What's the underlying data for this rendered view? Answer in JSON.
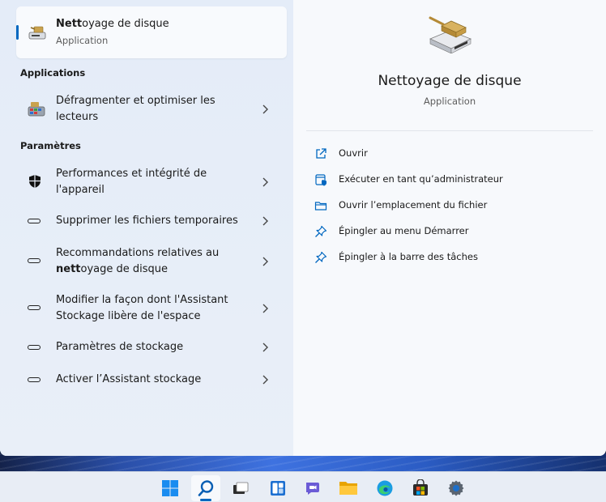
{
  "best_match": {
    "title_bold": "Nett",
    "title_rest": "oyage de disque",
    "subtitle": "Application",
    "icon": "disk-cleanup-icon"
  },
  "sections": {
    "applications": "Applications",
    "parametres": "Paramètres"
  },
  "applications": [
    {
      "line1": "Défragmenter et optimiser les",
      "line2": "lecteurs",
      "icon": "defragment-icon"
    }
  ],
  "settings": [
    {
      "line1": "Performances et intégrité de",
      "line2": "l'appareil",
      "icon": "shield-icon"
    },
    {
      "line1": "Supprimer les fichiers temporaires",
      "icon": "storage-drive-icon"
    },
    {
      "line1": "Recommandations relatives au",
      "line2_bold": "nett",
      "line2_rest": "oyage de disque",
      "icon": "storage-drive-icon"
    },
    {
      "line1": "Modifier la façon dont l'Assistant",
      "line2": "Stockage libère de l'espace",
      "icon": "storage-drive-icon"
    },
    {
      "line1": "Paramètres de stockage",
      "icon": "storage-drive-icon"
    },
    {
      "line1": "Activer l’Assistant stockage",
      "icon": "storage-drive-icon"
    }
  ],
  "detail": {
    "title": "Nettoyage de disque",
    "subtitle": "Application",
    "icon": "disk-cleanup-icon",
    "actions": [
      {
        "label": "Ouvrir",
        "icon": "open-icon"
      },
      {
        "label": "Exécuter en tant qu’administrateur",
        "icon": "admin-shield-icon"
      },
      {
        "label": "Ouvrir l’emplacement du fichier",
        "icon": "folder-icon"
      },
      {
        "label": "Épingler au menu Démarrer",
        "icon": "pin-icon"
      },
      {
        "label": "Épingler à la barre des tâches",
        "icon": "pin-icon"
      }
    ]
  },
  "taskbar": [
    {
      "name": "start",
      "icon": "windows-logo-icon"
    },
    {
      "name": "search",
      "icon": "search-icon",
      "active": true
    },
    {
      "name": "task-view",
      "icon": "task-view-icon"
    },
    {
      "name": "widgets",
      "icon": "widgets-icon"
    },
    {
      "name": "chat",
      "icon": "chat-icon"
    },
    {
      "name": "file-explorer",
      "icon": "folder-icon"
    },
    {
      "name": "edge",
      "icon": "edge-icon"
    },
    {
      "name": "store",
      "icon": "store-icon"
    },
    {
      "name": "settings",
      "icon": "gear-icon"
    }
  ],
  "colors": {
    "accent": "#0067c0",
    "panel_left": "#e9eff8",
    "panel_right": "#f7f9fc"
  }
}
